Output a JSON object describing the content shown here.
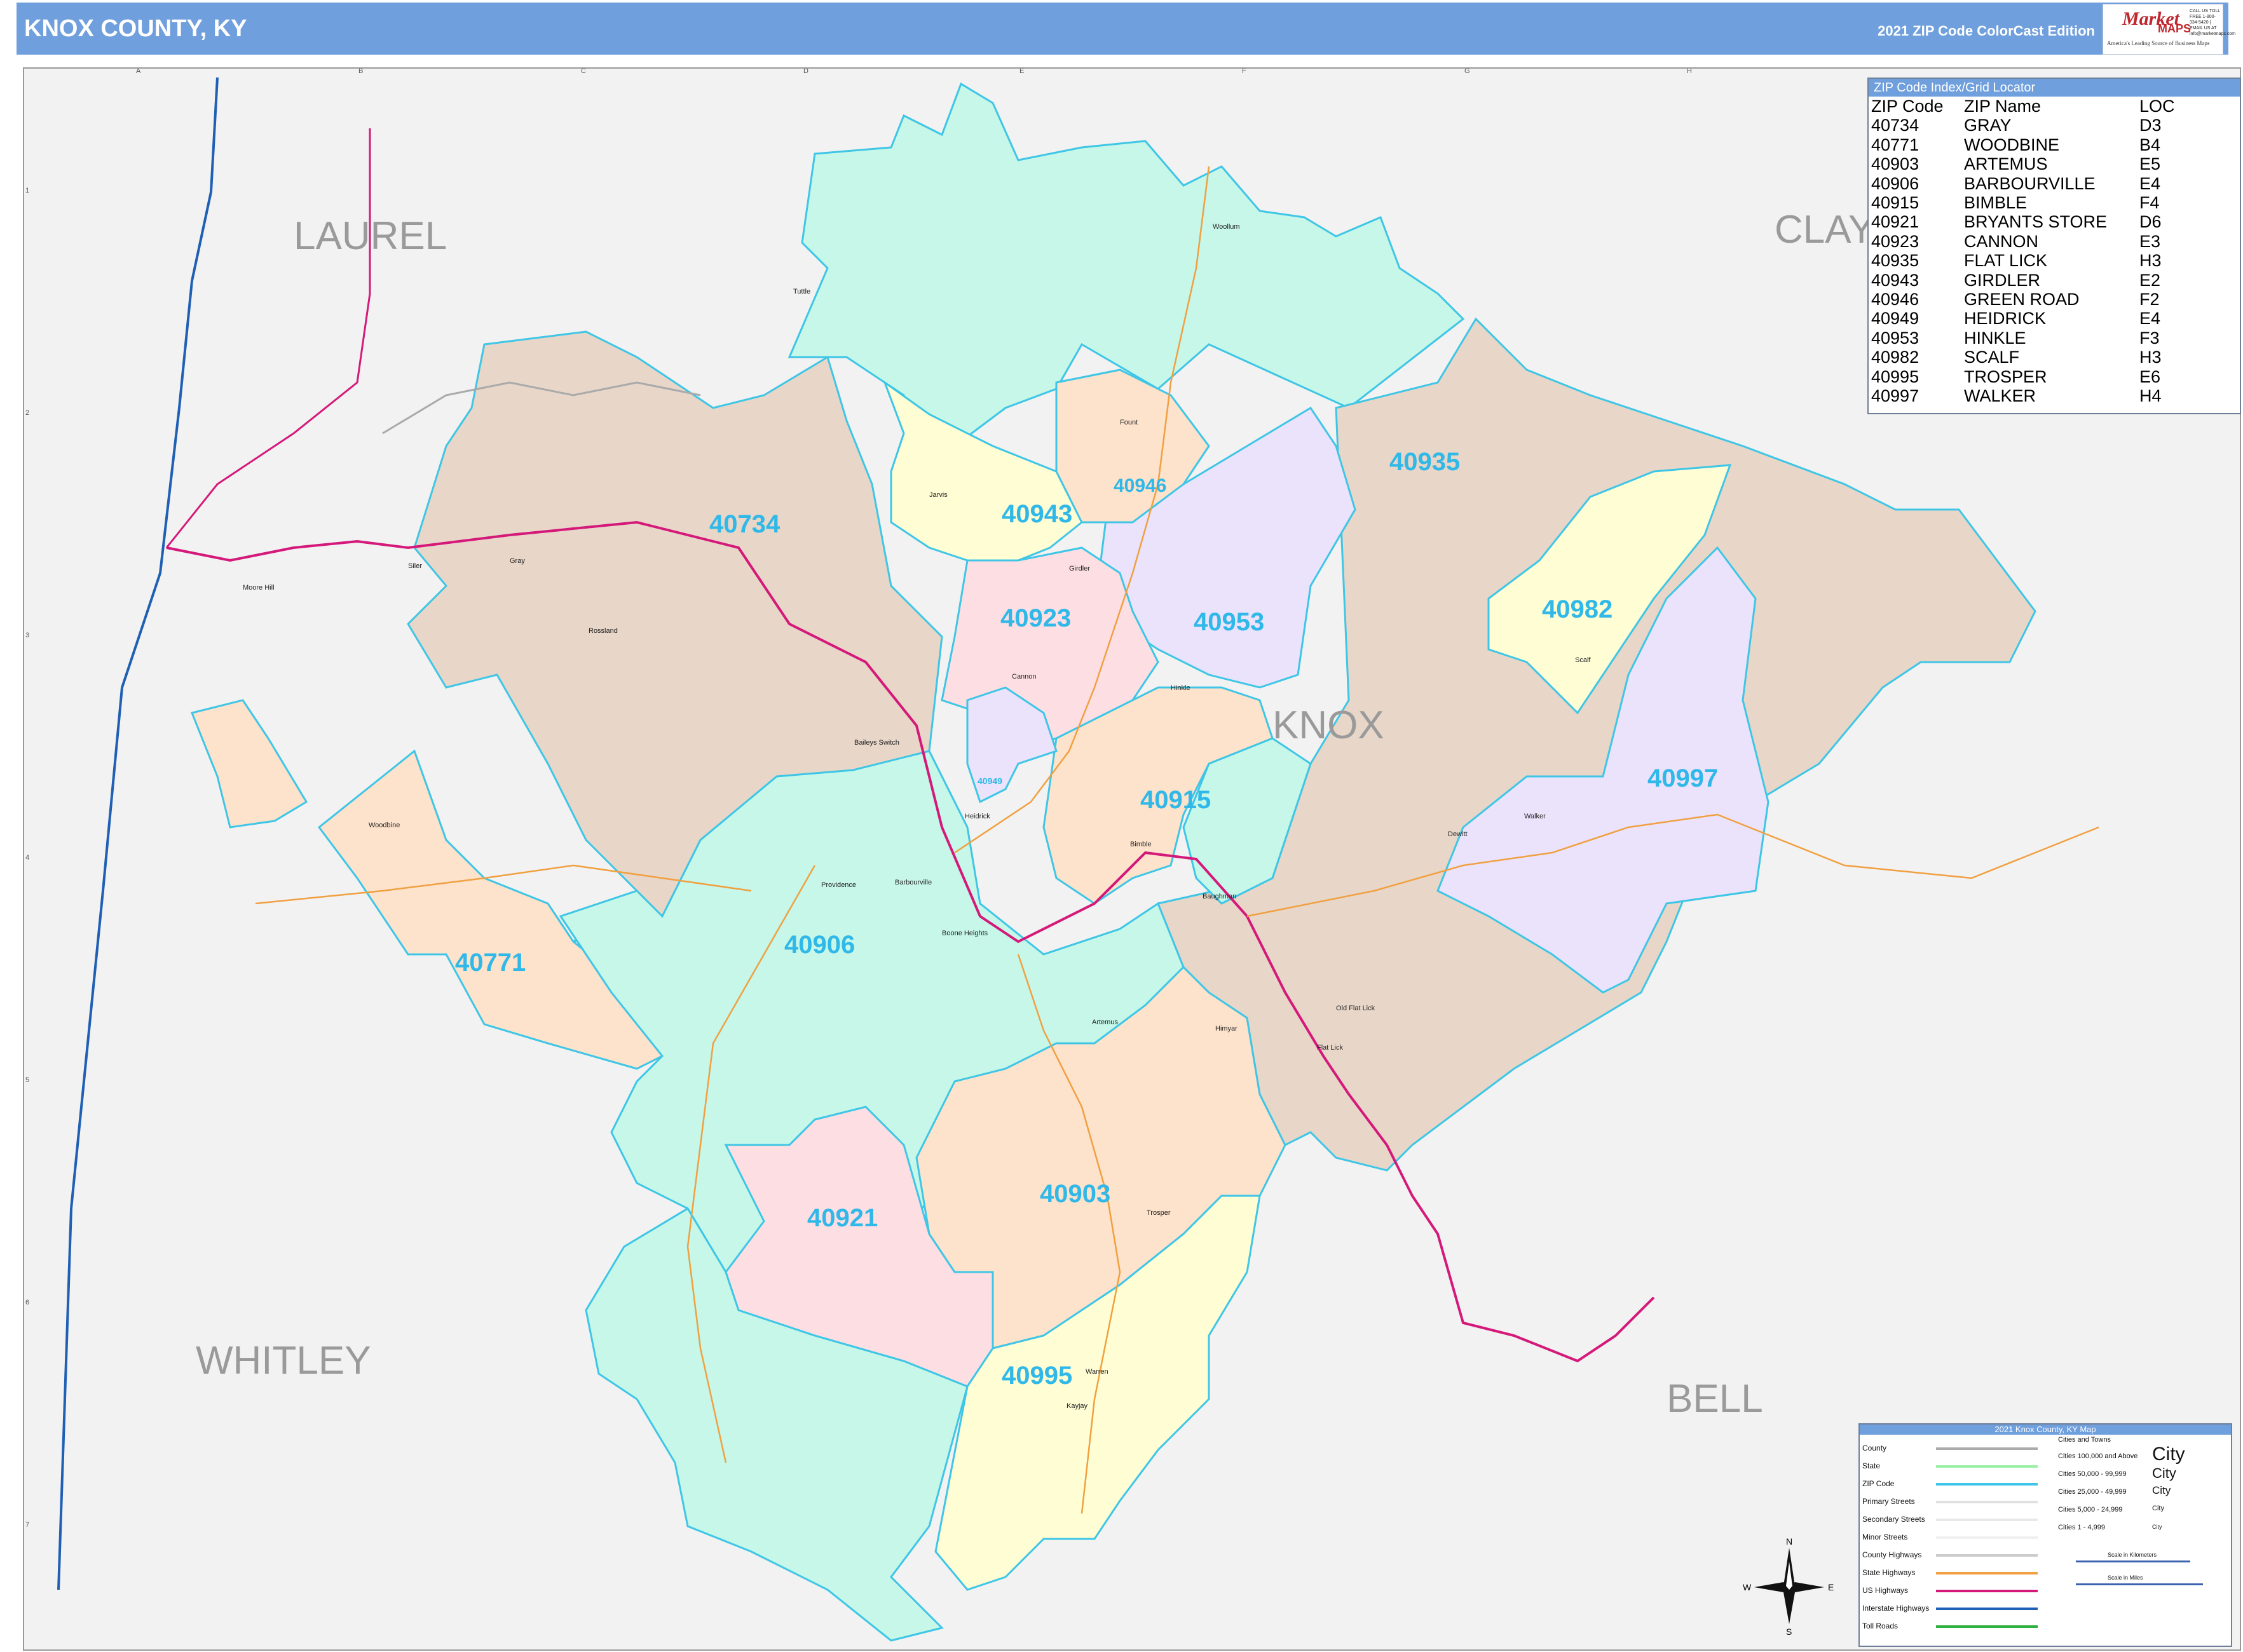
{
  "header": {
    "title": "KNOX COUNTY, KY",
    "edition": "2021 ZIP Code ColorCast Edition"
  },
  "logo": {
    "brand_market": "Market",
    "brand_maps": "MAPS",
    "tagline": "America's Leading Source of Business Maps",
    "contact": "CALL US TOLL FREE 1-800-334-5420 | EMAIL US AT info@marketmaps.com"
  },
  "counties": {
    "laurel": "LAUREL",
    "clay": "CLAY",
    "knox": "KNOX",
    "whitley": "WHITLEY",
    "bell": "BELL"
  },
  "zip_labels": [
    "40734",
    "40943",
    "40946",
    "40935",
    "40923",
    "40953",
    "40982",
    "40915",
    "40949",
    "40997",
    "40906",
    "40771",
    "40921",
    "40903",
    "40995"
  ],
  "places": [
    "Tuttle",
    "Woollum",
    "Fount",
    "Jarvis",
    "Girdler",
    "Cannon",
    "Hinkle",
    "Baileys Switch",
    "Heidrick",
    "Barbourville",
    "Providence",
    "Boone Heights",
    "Bimble",
    "Baughman",
    "Walker",
    "Scalf",
    "Dewitt",
    "Artemus",
    "Himyar",
    "Old Flat Lick",
    "Flat Lick",
    "Trosper",
    "Warren",
    "Kayjay",
    "Gray",
    "Rossland",
    "Moore Hill",
    "Woodbine",
    "Siler"
  ],
  "grid": {
    "columns": [
      "A",
      "B",
      "C",
      "D",
      "E",
      "F",
      "G",
      "H"
    ],
    "rows": [
      "1",
      "2",
      "3",
      "4",
      "5",
      "6",
      "7"
    ]
  },
  "zip_index": {
    "title": "ZIP Code Index/Grid Locator",
    "headers": [
      "ZIP Code",
      "ZIP Name",
      "LOC"
    ],
    "rows": [
      [
        "40734",
        "GRAY",
        "D3"
      ],
      [
        "40771",
        "WOODBINE",
        "B4"
      ],
      [
        "40903",
        "ARTEMUS",
        "E5"
      ],
      [
        "40906",
        "BARBOURVILLE",
        "E4"
      ],
      [
        "40915",
        "BIMBLE",
        "F4"
      ],
      [
        "40921",
        "BRYANTS STORE",
        "D6"
      ],
      [
        "40923",
        "CANNON",
        "E3"
      ],
      [
        "40935",
        "FLAT LICK",
        "H3"
      ],
      [
        "40943",
        "GIRDLER",
        "E2"
      ],
      [
        "40946",
        "GREEN ROAD",
        "F2"
      ],
      [
        "40949",
        "HEIDRICK",
        "E4"
      ],
      [
        "40953",
        "HINKLE",
        "F3"
      ],
      [
        "40982",
        "SCALF",
        "H3"
      ],
      [
        "40995",
        "TROSPER",
        "E6"
      ],
      [
        "40997",
        "WALKER",
        "H4"
      ]
    ]
  },
  "legend": {
    "title": "2021 Knox County, KY Map",
    "line_items": [
      "County",
      "State",
      "ZIP Code",
      "Primary Streets",
      "Secondary Streets",
      "Minor Streets",
      "County Highways",
      "State Highways",
      "US Highways",
      "Interstate Highways",
      "Toll Roads"
    ],
    "cities_title": "Cities and Towns",
    "city_sizes": [
      "Cities 100,000 and Above",
      "Cities 50,000 - 99,999",
      "Cities 25,000 - 49,999",
      "Cities 5,000 - 24,999",
      "Cities 1 - 4,999"
    ],
    "city_samples": [
      "City",
      "City",
      "City",
      "City",
      "City"
    ],
    "scale_km": "Scale in Kilometers",
    "scale_mi": "Scale in Miles"
  },
  "compass": {
    "n": "N",
    "s": "S",
    "e": "E",
    "w": "W"
  },
  "colors": {
    "header": "#6f9fdc",
    "zip_label": "#2fb8e8",
    "teal": "#c6f7e8",
    "brown": "#e8d6c8",
    "peach": "#fde2cc",
    "yellow": "#fefdd4",
    "lavender": "#ebe3fb",
    "pink": "#fddfe3",
    "county_bg": "#f2f2f2",
    "us_highway": "#d4197a",
    "interstate": "#1f5fb4"
  }
}
